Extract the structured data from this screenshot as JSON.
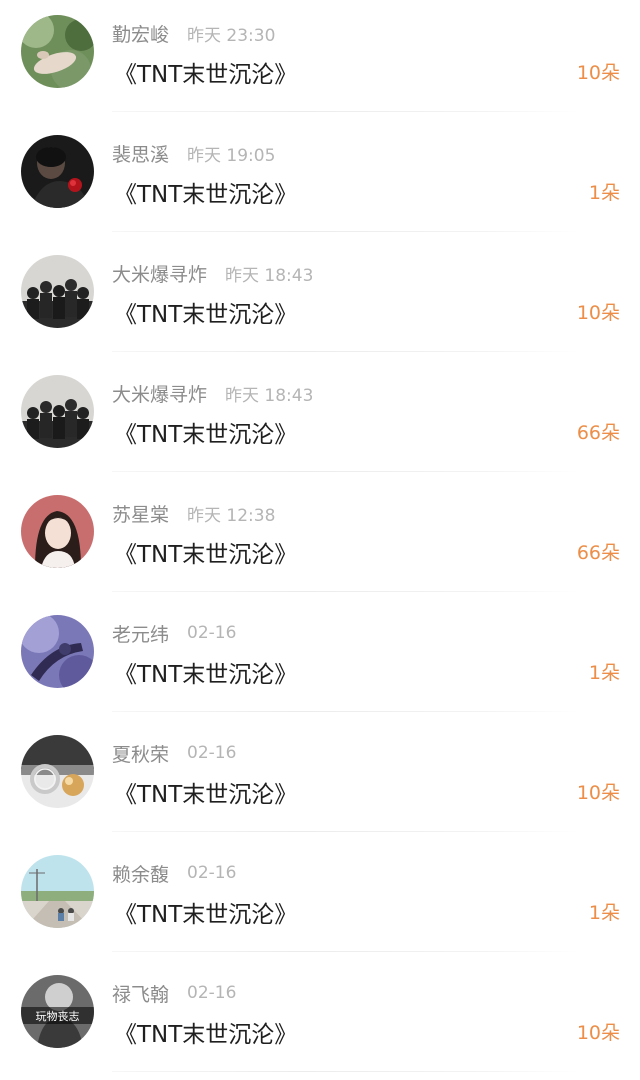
{
  "gifts": [
    {
      "sender": "勤宏峻",
      "time": "昨天 23:30",
      "title": "《TNT末世沉沦》",
      "count": "10朵",
      "avatar_icon": "nature-hand-avatar"
    },
    {
      "sender": "裴思溪",
      "time": "昨天 19:05",
      "title": "《TNT末世沉沦》",
      "count": "1朵",
      "avatar_icon": "man-rose-avatar"
    },
    {
      "sender": "大米爆寻炸",
      "time": "昨天 18:43",
      "title": "《TNT末世沉沦》",
      "count": "10朵",
      "avatar_icon": "group-photo-avatar"
    },
    {
      "sender": "大米爆寻炸",
      "time": "昨天 18:43",
      "title": "《TNT末世沉沦》",
      "count": "66朵",
      "avatar_icon": "group-photo-avatar"
    },
    {
      "sender": "苏星棠",
      "time": "昨天 12:38",
      "title": "《TNT末世沉沦》",
      "count": "66朵",
      "avatar_icon": "girl-portrait-avatar"
    },
    {
      "sender": "老元纬",
      "time": "02-16",
      "title": "《TNT末世沉沦》",
      "count": "1朵",
      "avatar_icon": "purple-art-avatar"
    },
    {
      "sender": "夏秋荣",
      "time": "02-16",
      "title": "《TNT末世沉沦》",
      "count": "10朵",
      "avatar_icon": "pearl-ring-avatar"
    },
    {
      "sender": "赖余馥",
      "time": "02-16",
      "title": "《TNT末世沉沦》",
      "count": "1朵",
      "avatar_icon": "road-landscape-avatar"
    },
    {
      "sender": "禄飞翰",
      "time": "02-16",
      "title": "《TNT末世沉沦》",
      "count": "10朵",
      "avatar_icon": "text-portrait-avatar",
      "avatar_text": "玩物丧志"
    }
  ],
  "colors": {
    "accent": "#ec8e48",
    "name": "#8c8c8c",
    "time": "#b5b5b5",
    "title": "#1f1f1f"
  }
}
